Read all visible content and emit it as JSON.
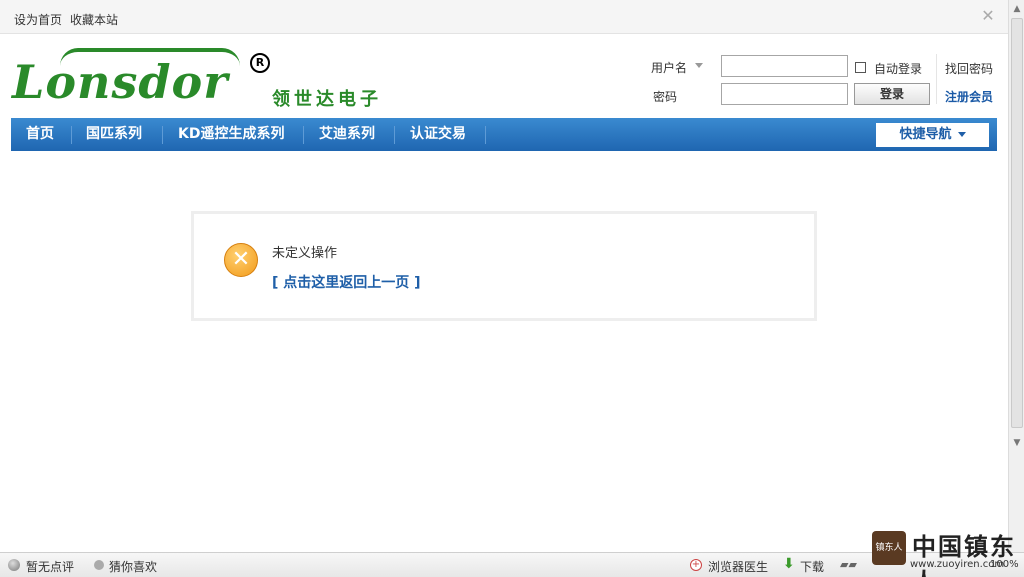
{
  "topbar": {
    "set_home": "设为首页",
    "bookmark": "收藏本站"
  },
  "logo": {
    "brand": "Lonsdor",
    "reg_mark": "R",
    "cn_name": "领世达电子"
  },
  "login": {
    "username_label": "用户名",
    "password_label": "密码",
    "username_value": "",
    "password_value": "",
    "auto_login_label": "自动登录",
    "login_button": "登录",
    "forgot_password": "找回密码",
    "register": "注册会员"
  },
  "nav": {
    "items": [
      {
        "label": "首页"
      },
      {
        "label": "国匹系列"
      },
      {
        "label": "KD遥控生成系列"
      },
      {
        "label": "艾迪系列"
      },
      {
        "label": "认证交易"
      }
    ],
    "quick_nav": "快捷导航"
  },
  "message": {
    "text": "未定义操作",
    "back_link": "[ 点击这里返回上一页 ]"
  },
  "statusbar": {
    "no_review": "暂无点评",
    "guess_like": "猜你喜欢",
    "browser_doctor": "浏览器医生",
    "download": "下载",
    "zoom": "100%"
  },
  "watermark": {
    "seal_text": "镇东人",
    "title": "中国镇东人",
    "url": "www.zuoyiren.com"
  },
  "colors": {
    "nav_bg": "#1f66b1",
    "link_blue": "#1f5fa8",
    "brand_green": "#2a8a2a",
    "warning_orange": "#f29a1a"
  }
}
